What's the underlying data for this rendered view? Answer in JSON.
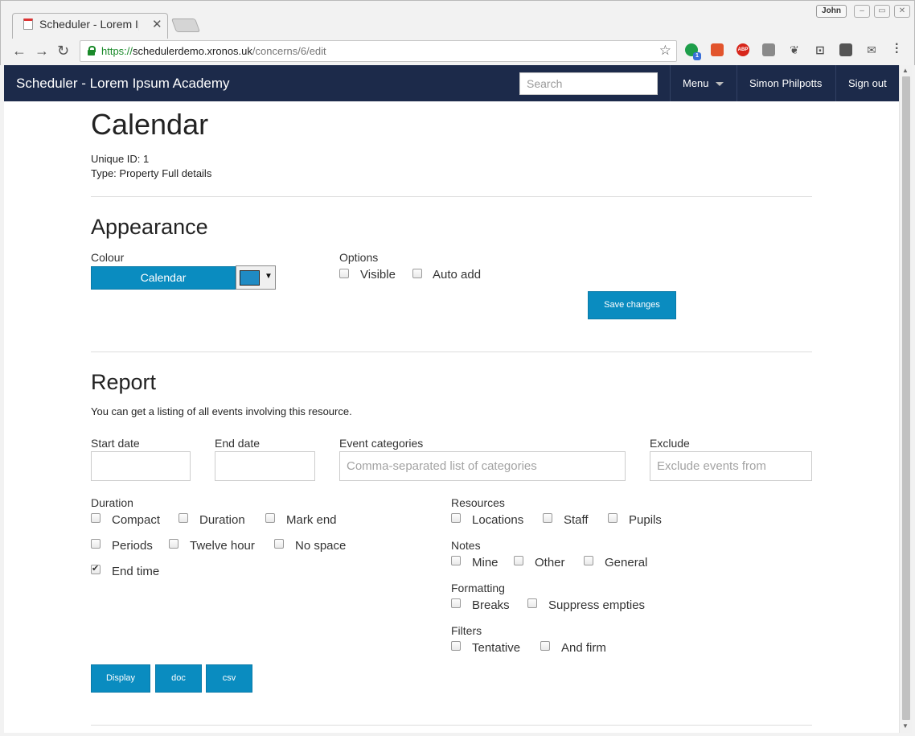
{
  "browser": {
    "tab_title": "Scheduler - Lorem Ipsum Academy",
    "url_scheme": "https://",
    "url_host": "schedulerdemo.xronos.uk",
    "url_path": "/concerns/6/edit",
    "profile_name": "John",
    "ext_badge": "1"
  },
  "navbar": {
    "brand": "Scheduler - Lorem Ipsum Academy",
    "search_placeholder": "Search",
    "menu_label": "Menu",
    "user_name": "Simon Philpotts",
    "signout_label": "Sign out",
    "bg_color": "#1c2a4a"
  },
  "page": {
    "title": "Calendar",
    "unique_id_label": "Unique ID:",
    "unique_id_value": "1",
    "type_label": "Type:",
    "type_value": "Property",
    "full_details_link": "Full details"
  },
  "appearance": {
    "heading": "Appearance",
    "colour_label": "Colour",
    "colour_button": "Calendar",
    "colour_value": "#1f8bc4",
    "options_label": "Options",
    "options": [
      {
        "label": "Visible",
        "checked": false
      },
      {
        "label": "Auto add",
        "checked": false
      }
    ],
    "save_label": "Save changes"
  },
  "report": {
    "heading": "Report",
    "description": "You can get a listing of all events involving this resource.",
    "start_date_label": "Start date",
    "end_date_label": "End date",
    "categories_label": "Event categories",
    "categories_placeholder": "Comma-separated list of categories",
    "exclude_label": "Exclude",
    "exclude_placeholder": "Exclude events from",
    "duration_label": "Duration",
    "duration_options": [
      {
        "label": "Compact",
        "checked": false
      },
      {
        "label": "Duration",
        "checked": false
      },
      {
        "label": "Mark end",
        "checked": false
      },
      {
        "label": "Periods",
        "checked": false
      },
      {
        "label": "Twelve hour",
        "checked": false
      },
      {
        "label": "No space",
        "checked": false
      },
      {
        "label": "End time",
        "checked": true
      }
    ],
    "resources_label": "Resources",
    "resources_options": [
      {
        "label": "Locations",
        "checked": false
      },
      {
        "label": "Staff",
        "checked": false
      },
      {
        "label": "Pupils",
        "checked": false
      }
    ],
    "notes_label": "Notes",
    "notes_options": [
      {
        "label": "Mine",
        "checked": false
      },
      {
        "label": "Other",
        "checked": false
      },
      {
        "label": "General",
        "checked": false
      }
    ],
    "formatting_label": "Formatting",
    "formatting_options": [
      {
        "label": "Breaks",
        "checked": false
      },
      {
        "label": "Suppress empties",
        "checked": false
      }
    ],
    "filters_label": "Filters",
    "filters_options": [
      {
        "label": "Tentative",
        "checked": false
      },
      {
        "label": "And firm",
        "checked": false
      }
    ],
    "display_button": "Display",
    "doc_button": "doc",
    "csv_button": "csv"
  }
}
